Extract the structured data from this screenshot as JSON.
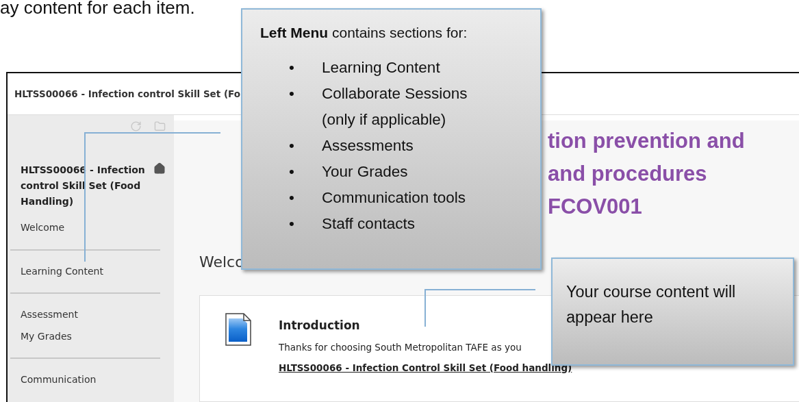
{
  "document_text": "ay content for each item.",
  "screenshot": {
    "title": "HLTSS00066 - Infection control Skill Set (Fo",
    "sidebar": {
      "course_title": "HLTSS00066 - Infection control Skill Set (Food Handling)",
      "sections": [
        {
          "items": [
            "Welcome"
          ]
        },
        {
          "items": [
            "Learning Content"
          ]
        },
        {
          "items": [
            "Assessment",
            "My Grades"
          ]
        },
        {
          "items": [
            "Communication"
          ]
        }
      ]
    },
    "main": {
      "heading_lines": [
        "tion prevention and",
        "and procedures",
        "FCOV001"
      ],
      "welcome": "Welco",
      "card": {
        "title": "Introduction",
        "text": "Thanks for choosing South Metropolitan TAFE as you",
        "link": "HLTSS00066 - Infection Control Skill Set (Food handling)"
      }
    }
  },
  "callouts": [
    {
      "kind": "list",
      "marker": "•",
      "title": "**Left Menu** contains sections for:",
      "items": [
        "Learning Content",
        "Collaborate Sessions (only if applicable)",
        "Assessments",
        "Your Grades",
        "Communication tools",
        "Staff contacts"
      ]
    },
    {
      "kind": "note",
      "text": "Your course content will appear here"
    }
  ]
}
